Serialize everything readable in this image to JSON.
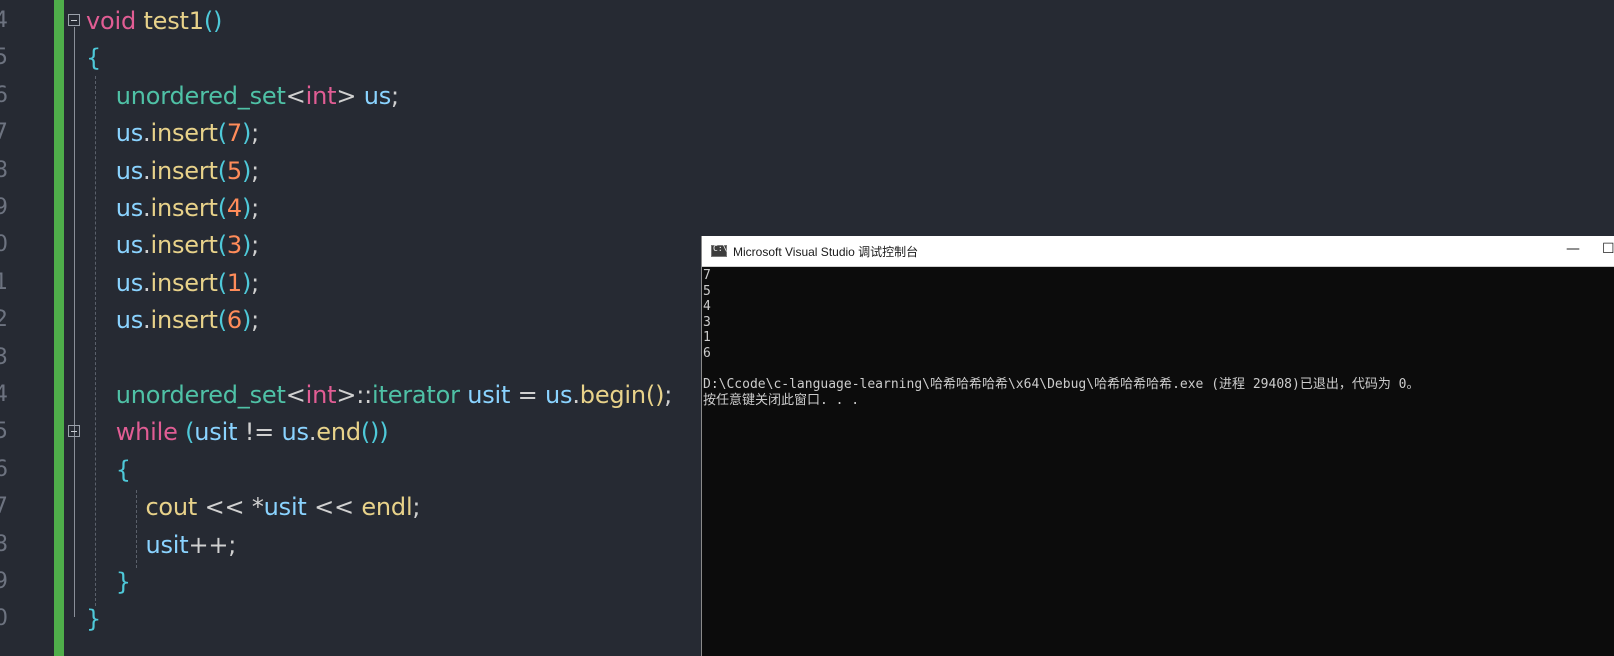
{
  "editor": {
    "line_numbers": [
      "4",
      "5",
      "6",
      "7",
      "8",
      "9",
      "0",
      "1",
      "2",
      "3",
      "4",
      "5",
      "6",
      "7",
      "8",
      "9",
      "0"
    ],
    "colors": {
      "background": "#262a33",
      "change_bar": "#4fae4a",
      "keyword": "#e15d94",
      "function": "#e8d28a",
      "type": "#4fc1a6",
      "identifier": "#8ad3ff",
      "number": "#ff8c5a",
      "brace": "#4ec9d9"
    },
    "code": [
      [
        {
          "c": "kw",
          "t": "void"
        },
        {
          "c": "pl",
          "t": " "
        },
        {
          "c": "fn",
          "t": "test1"
        },
        {
          "c": "br",
          "t": "()"
        }
      ],
      [
        {
          "c": "br",
          "t": "{"
        }
      ],
      [
        {
          "c": "pl",
          "t": "    "
        },
        {
          "c": "ty",
          "t": "unordered_set"
        },
        {
          "c": "op",
          "t": "<"
        },
        {
          "c": "kw",
          "t": "int"
        },
        {
          "c": "op",
          "t": ">"
        },
        {
          "c": "pl",
          "t": " "
        },
        {
          "c": "id",
          "t": "us"
        },
        {
          "c": "op",
          "t": ";"
        }
      ],
      [
        {
          "c": "pl",
          "t": "    "
        },
        {
          "c": "id",
          "t": "us"
        },
        {
          "c": "op",
          "t": "."
        },
        {
          "c": "fn",
          "t": "insert"
        },
        {
          "c": "br",
          "t": "("
        },
        {
          "c": "num",
          "t": "7"
        },
        {
          "c": "br",
          "t": ")"
        },
        {
          "c": "op",
          "t": ";"
        }
      ],
      [
        {
          "c": "pl",
          "t": "    "
        },
        {
          "c": "id",
          "t": "us"
        },
        {
          "c": "op",
          "t": "."
        },
        {
          "c": "fn",
          "t": "insert"
        },
        {
          "c": "br",
          "t": "("
        },
        {
          "c": "num",
          "t": "5"
        },
        {
          "c": "br",
          "t": ")"
        },
        {
          "c": "op",
          "t": ";"
        }
      ],
      [
        {
          "c": "pl",
          "t": "    "
        },
        {
          "c": "id",
          "t": "us"
        },
        {
          "c": "op",
          "t": "."
        },
        {
          "c": "fn",
          "t": "insert"
        },
        {
          "c": "br",
          "t": "("
        },
        {
          "c": "num",
          "t": "4"
        },
        {
          "c": "br",
          "t": ")"
        },
        {
          "c": "op",
          "t": ";"
        }
      ],
      [
        {
          "c": "pl",
          "t": "    "
        },
        {
          "c": "id",
          "t": "us"
        },
        {
          "c": "op",
          "t": "."
        },
        {
          "c": "fn",
          "t": "insert"
        },
        {
          "c": "br",
          "t": "("
        },
        {
          "c": "num",
          "t": "3"
        },
        {
          "c": "br",
          "t": ")"
        },
        {
          "c": "op",
          "t": ";"
        }
      ],
      [
        {
          "c": "pl",
          "t": "    "
        },
        {
          "c": "id",
          "t": "us"
        },
        {
          "c": "op",
          "t": "."
        },
        {
          "c": "fn",
          "t": "insert"
        },
        {
          "c": "br",
          "t": "("
        },
        {
          "c": "num",
          "t": "1"
        },
        {
          "c": "br",
          "t": ")"
        },
        {
          "c": "op",
          "t": ";"
        }
      ],
      [
        {
          "c": "pl",
          "t": "    "
        },
        {
          "c": "id",
          "t": "us"
        },
        {
          "c": "op",
          "t": "."
        },
        {
          "c": "fn",
          "t": "insert"
        },
        {
          "c": "br",
          "t": "("
        },
        {
          "c": "num",
          "t": "6"
        },
        {
          "c": "br",
          "t": ")"
        },
        {
          "c": "op",
          "t": ";"
        }
      ],
      [],
      [
        {
          "c": "pl",
          "t": "    "
        },
        {
          "c": "ty",
          "t": "unordered_set"
        },
        {
          "c": "op",
          "t": "<"
        },
        {
          "c": "kw",
          "t": "int"
        },
        {
          "c": "op",
          "t": ">::"
        },
        {
          "c": "ty",
          "t": "iterator"
        },
        {
          "c": "pl",
          "t": " "
        },
        {
          "c": "id",
          "t": "usit"
        },
        {
          "c": "op",
          "t": " = "
        },
        {
          "c": "id",
          "t": "us"
        },
        {
          "c": "op",
          "t": "."
        },
        {
          "c": "fn",
          "t": "begin"
        },
        {
          "c": "fn",
          "t": "()"
        },
        {
          "c": "op",
          "t": ";"
        }
      ],
      [
        {
          "c": "pl",
          "t": "    "
        },
        {
          "c": "kw",
          "t": "while"
        },
        {
          "c": "pl",
          "t": " "
        },
        {
          "c": "br",
          "t": "("
        },
        {
          "c": "id",
          "t": "usit"
        },
        {
          "c": "op",
          "t": " != "
        },
        {
          "c": "id",
          "t": "us"
        },
        {
          "c": "op",
          "t": "."
        },
        {
          "c": "fn",
          "t": "end"
        },
        {
          "c": "br",
          "t": "())"
        }
      ],
      [
        {
          "c": "pl",
          "t": "    "
        },
        {
          "c": "br",
          "t": "{"
        }
      ],
      [
        {
          "c": "pl",
          "t": "        "
        },
        {
          "c": "fn",
          "t": "cout"
        },
        {
          "c": "op",
          "t": " << "
        },
        {
          "c": "op",
          "t": "*"
        },
        {
          "c": "id",
          "t": "usit"
        },
        {
          "c": "op",
          "t": " << "
        },
        {
          "c": "fn",
          "t": "endl"
        },
        {
          "c": "op",
          "t": ";"
        }
      ],
      [
        {
          "c": "pl",
          "t": "        "
        },
        {
          "c": "id",
          "t": "usit"
        },
        {
          "c": "op",
          "t": "++;"
        }
      ],
      [
        {
          "c": "pl",
          "t": "    "
        },
        {
          "c": "br",
          "t": "}"
        }
      ],
      [
        {
          "c": "br",
          "t": "}"
        }
      ]
    ]
  },
  "console": {
    "title": "Microsoft Visual Studio 调试控制台",
    "minimize_glyph": "—",
    "maximize_glyph": "☐",
    "output": [
      "7",
      "5",
      "4",
      "3",
      "1",
      "6",
      "",
      "D:\\Ccode\\c-language-learning\\哈希哈希哈希\\x64\\Debug\\哈希哈希哈希.exe (进程 29408)已退出，代码为 0。",
      "按任意键关闭此窗口. . ."
    ]
  }
}
